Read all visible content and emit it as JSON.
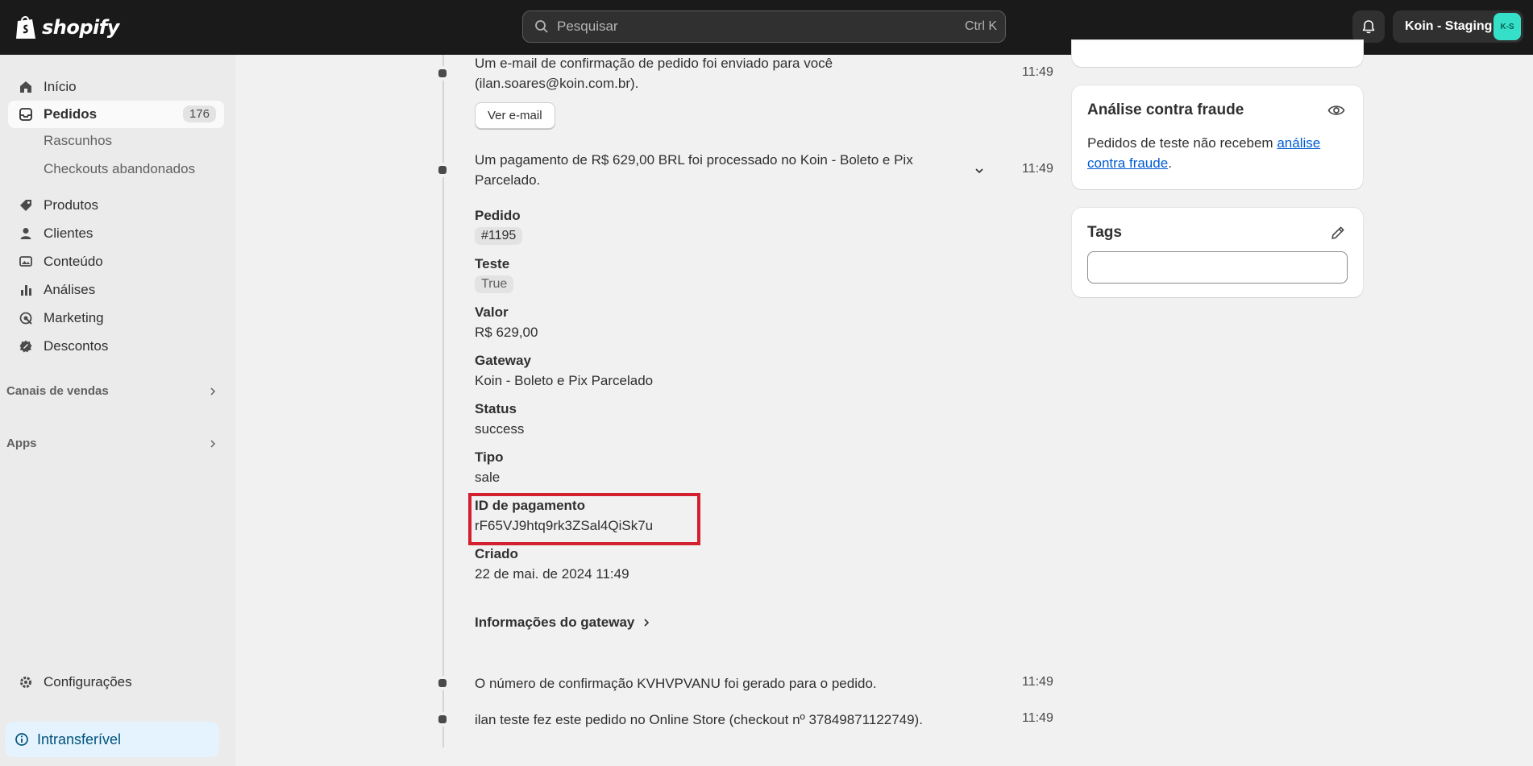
{
  "topbar": {
    "logo_text": "shopify",
    "search_placeholder": "Pesquisar",
    "search_shortcut": "Ctrl K",
    "store_name": "Koin - Staging",
    "store_initials": "K-S"
  },
  "sidebar": {
    "home": "Início",
    "orders": "Pedidos",
    "orders_count": "176",
    "drafts": "Rascunhos",
    "abandoned": "Checkouts abandonados",
    "products": "Produtos",
    "customers": "Clientes",
    "content": "Conteúdo",
    "analytics": "Análises",
    "marketing": "Marketing",
    "discounts": "Descontos",
    "sales_channels": "Canais de vendas",
    "apps": "Apps",
    "settings": "Configurações",
    "nontransferable": "Intransferível"
  },
  "timeline": {
    "email_event_line1": "Um e-mail de confirmação de pedido foi enviado para você",
    "email_event_line2": "(ilan.soares@koin.com.br).",
    "email_event_time": "11:49",
    "view_email_button": "Ver e-mail",
    "payment_event_line1": "Um pagamento de R$ 629,00 BRL foi processado no Koin - Boleto e Pix",
    "payment_event_line2": "Parcelado.",
    "payment_event_time": "11:49",
    "details": {
      "order_label": "Pedido",
      "order_value": "#1195",
      "test_label": "Teste",
      "test_value": "True",
      "amount_label": "Valor",
      "amount_value": "R$ 629,00",
      "gateway_label": "Gateway",
      "gateway_value": "Koin - Boleto e Pix Parcelado",
      "status_label": "Status",
      "status_value": "success",
      "type_label": "Tipo",
      "type_value": "sale",
      "payment_id_label": "ID de pagamento",
      "payment_id_value": "rF65VJ9htq9rk3ZSal4QiSk7u",
      "created_label": "Criado",
      "created_value": "22 de mai. de 2024 11:49"
    },
    "gateway_info_link": "Informações do gateway",
    "confirmation_event": "O número de confirmação KVHVPVANU foi gerado para o pedido.",
    "confirmation_event_time": "11:49",
    "placed_event": "ilan teste fez este pedido no Online Store (checkout nº 37849871122749).",
    "placed_event_time": "11:49"
  },
  "fraud_card": {
    "title": "Análise contra fraude",
    "text_prefix": "Pedidos de teste não recebem ",
    "link_text": "análise contra fraude",
    "text_suffix": "."
  },
  "tags_card": {
    "title": "Tags",
    "input_value": ""
  },
  "colors": {
    "topbar": "#1a1a1a",
    "highlight": "#d3202f",
    "link": "#005bd3",
    "avatar": "#36e0c8"
  }
}
